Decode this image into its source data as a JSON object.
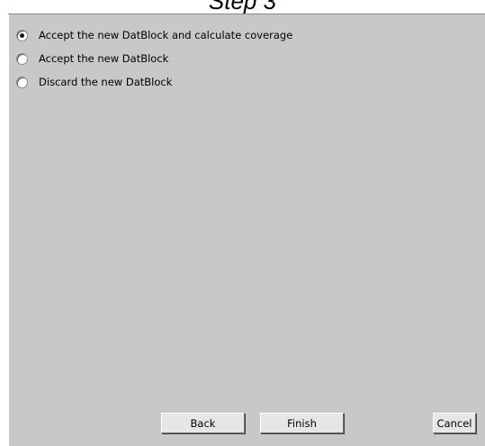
{
  "window": {
    "title": "Step 3"
  },
  "options": [
    {
      "label": "Accept the new DatBlock and calculate coverage",
      "checked": true
    },
    {
      "label": "Accept the new DatBlock",
      "checked": false
    },
    {
      "label": "Discard the new DatBlock",
      "checked": false
    }
  ],
  "buttons": {
    "back_label": "Back",
    "finish_label": "Finish",
    "cancel_label": "Cancel"
  }
}
